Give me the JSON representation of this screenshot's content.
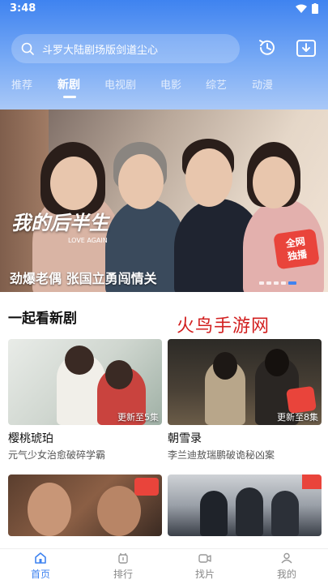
{
  "status_bar": {
    "time": "3:48"
  },
  "search": {
    "placeholder": "斗罗大陆剧场版剑道尘心"
  },
  "tabs": [
    {
      "label": "推荐"
    },
    {
      "label": "新剧"
    },
    {
      "label": "电视剧"
    },
    {
      "label": "电影"
    },
    {
      "label": "综艺"
    },
    {
      "label": "动漫"
    }
  ],
  "active_tab": "新剧",
  "banner": {
    "title": "劲爆老偶 张国立勇闯情关",
    "show_logo": "我的后半生",
    "show_logo_en": "LOVE AGAIN",
    "badge": [
      "全网",
      "独播"
    ],
    "slides_total": 5,
    "active_slide": 5
  },
  "section": {
    "title": "一起看新剧"
  },
  "watermark": "火鸟手游网",
  "cards": [
    {
      "title": "樱桃琥珀",
      "update": "更新至5集",
      "desc": "元气少女治愈破碎学霸"
    },
    {
      "title": "朝雪录",
      "update": "更新至8集",
      "desc": "李兰迪敖瑞鹏破诡秘凶案"
    }
  ],
  "bottom_nav": [
    {
      "label": "首页",
      "icon": "home-icon"
    },
    {
      "label": "排行",
      "icon": "ranking-icon"
    },
    {
      "label": "找片",
      "icon": "video-search-icon"
    },
    {
      "label": "我的",
      "icon": "profile-icon"
    }
  ],
  "colors": {
    "accent": "#3f83f0",
    "badge": "#e9443b",
    "watermark": "#d21f1f"
  }
}
